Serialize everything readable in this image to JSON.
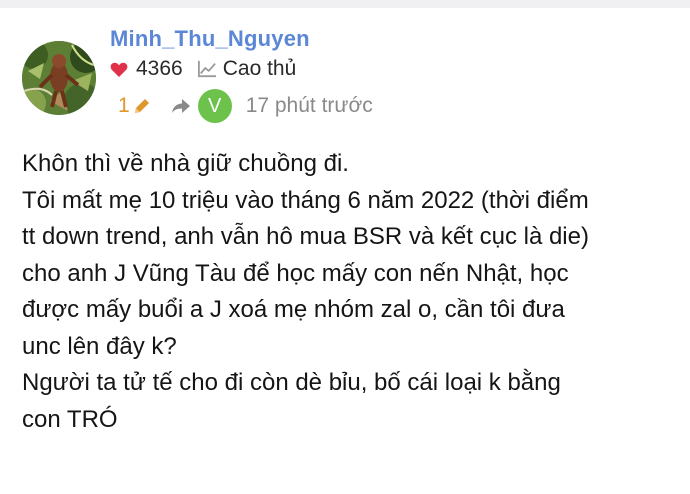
{
  "post": {
    "author": {
      "username": "Minh_Thu_Nguyen",
      "likes": "4366",
      "rank": "Cao thủ"
    },
    "meta": {
      "edit_count": "1",
      "reply_to_initial": "V",
      "time_ago": "17 phút trước"
    },
    "body_lines": [
      "Khôn thì về nhà giữ chuồng đi.",
      "Tôi mất mẹ 10 triệu vào tháng 6 năm 2022 (thời điểm",
      "tt down trend, anh vẫn hô mua BSR và kết cục là die)",
      "cho anh J Vũng Tàu để học mấy con nến Nhật, học",
      "được mấy buổi a J xoá mẹ nhóm zal o, cần tôi đưa",
      "unc lên đây k?",
      "Người ta tử tế cho đi còn dè bỉu, bố cái loại k bằng",
      "con TRÓ"
    ]
  },
  "colors": {
    "username": "#5b87d6",
    "heart": "#e0314b",
    "edit": "#e0972a",
    "reply_avatar": "#6cc24a",
    "muted": "#8a8a8a"
  },
  "icons": [
    "heart-icon",
    "trend-chart-icon",
    "pencil-icon",
    "reply-arrow-icon"
  ]
}
